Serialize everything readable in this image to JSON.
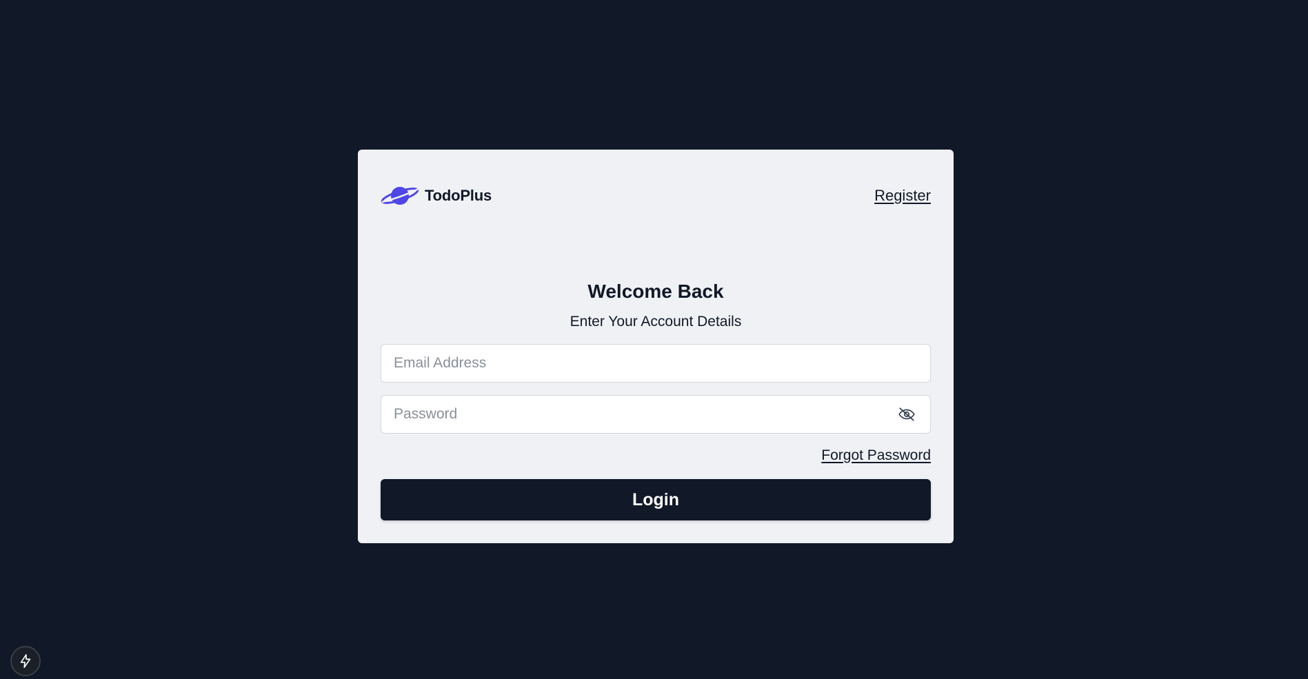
{
  "brand": {
    "name": "TodoPlus",
    "logo_icon": "planet-icon",
    "logo_color": "#4f46e5"
  },
  "header": {
    "register_label": "Register"
  },
  "form": {
    "title": "Welcome Back",
    "subtitle": "Enter Your Account Details",
    "email": {
      "value": "",
      "placeholder": "Email Address"
    },
    "password": {
      "value": "",
      "placeholder": "Password",
      "toggle_icon": "eye-off-icon"
    },
    "forgot_password_label": "Forgot Password",
    "login_label": "Login"
  },
  "devtools": {
    "icon": "lightning-bolt-icon"
  },
  "colors": {
    "page_background": "#111827",
    "card_background": "#f0f1f5",
    "primary": "#111827",
    "text_on_primary": "#ffffff"
  }
}
